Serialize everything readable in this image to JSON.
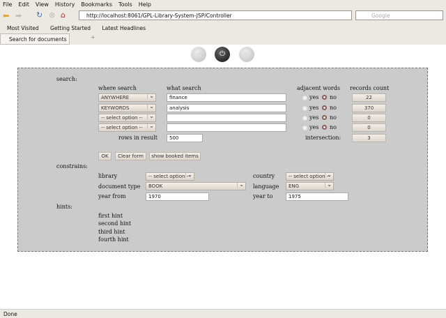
{
  "browser": {
    "menu": [
      "File",
      "Edit",
      "View",
      "History",
      "Bookmarks",
      "Tools",
      "Help"
    ],
    "url": "http://localhost:8061/GPL-Library-System-JSP/Controller",
    "search_placeholder": "Google",
    "bookmarks": [
      "Most Visited",
      "Getting Started",
      "Latest Headlines"
    ],
    "tab": "Search for documents",
    "status": "Done"
  },
  "search": {
    "label": "search:",
    "headers": {
      "where": "where search",
      "what": "what search",
      "adjacent": "adjacent words",
      "count": "records count"
    },
    "rows": [
      {
        "where": "ANYWHERE",
        "what": "finance",
        "count": "22"
      },
      {
        "where": "KEYWORDS",
        "what": "analysis",
        "count": "370"
      },
      {
        "where": "-- select option --",
        "what": "",
        "count": "0"
      },
      {
        "where": "-- select option --",
        "what": "",
        "count": "0"
      }
    ],
    "yes": "yes",
    "no": "no",
    "rows_label": "rows in result",
    "rows_value": "500",
    "intersection_label": "intersection:",
    "intersection_value": "3",
    "ok": "OK",
    "clear": "Clear form",
    "booked": "show booked items"
  },
  "constraints": {
    "label": "constrains:",
    "library_label": "library",
    "library": "-- select option --",
    "country_label": "country",
    "country": "-- select option --",
    "doctype_label": "document type",
    "doctype": "BOOK",
    "language_label": "language",
    "language": "ENG",
    "year_from_label": "year from",
    "year_from": "1970",
    "year_to_label": "year to",
    "year_to": "1975"
  },
  "hints": {
    "label": "hints:",
    "items": [
      "first hint",
      "second hint",
      "third hint",
      "fourth hint"
    ]
  }
}
